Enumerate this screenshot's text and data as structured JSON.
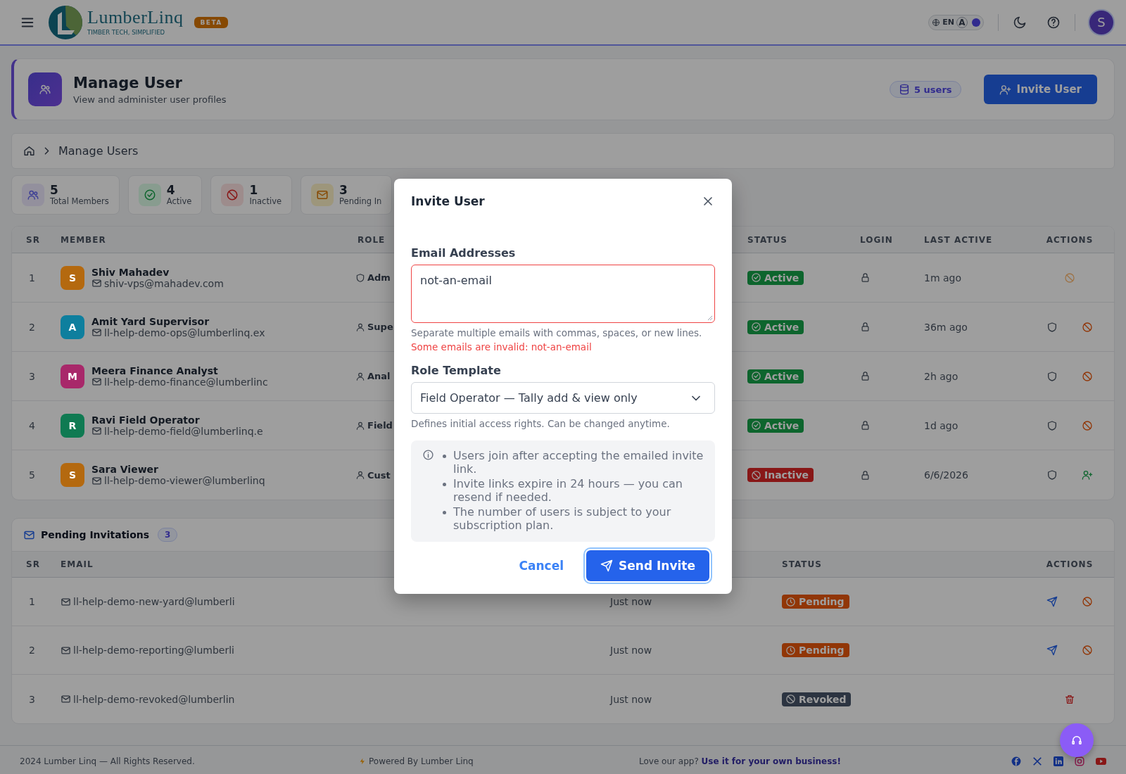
{
  "header": {
    "logo_name": "LumberLinq",
    "logo_tagline": "TIMBER TECH, SIMPLIFIED",
    "badge": "BETA",
    "language": "EN",
    "font_toggle": "A",
    "avatar": "S"
  },
  "page_header": {
    "title": "Manage User",
    "subtitle": "View and administer user profiles",
    "count": "5 users",
    "invite_button": "Invite User"
  },
  "breadcrumb": {
    "current": "Manage Users"
  },
  "stats": [
    {
      "kind": "members",
      "value": "5",
      "label": "Total Members"
    },
    {
      "kind": "active",
      "value": "4",
      "label": "Active"
    },
    {
      "kind": "inactive",
      "value": "1",
      "label": "Inactive"
    },
    {
      "kind": "pending",
      "value": "3",
      "label": "Pending In"
    }
  ],
  "members": {
    "columns": [
      "SR",
      "MEMBER",
      "ROLE",
      "STATUS",
      "LOGIN",
      "LAST ACTIVE",
      "ACTIONS"
    ],
    "rows": [
      {
        "sr": "1",
        "initial": "S",
        "color": "#b4690f",
        "name": "Shiv Mahadev",
        "email": "shiv-vps@mahadev.com",
        "role": {
          "kind": "admin",
          "label": "Adm"
        },
        "status": {
          "kind": "active",
          "label": "Active"
        },
        "last_active": "1m ago",
        "actions": [
          {
            "kind": "block",
            "disabled": true
          }
        ]
      },
      {
        "sr": "2",
        "initial": "A",
        "color": "#0e7f9e",
        "name": "Amit Yard Supervisor",
        "email": "ll-help-demo-ops@lumberlinq.ex",
        "role": {
          "kind": "user",
          "label": "Supe"
        },
        "status": {
          "kind": "active",
          "label": "Active"
        },
        "last_active": "36m ago",
        "actions": [
          {
            "kind": "permissions",
            "disabled": false
          },
          {
            "kind": "block",
            "disabled": false
          }
        ]
      },
      {
        "sr": "3",
        "initial": "M",
        "color": "#a8286a",
        "name": "Meera Finance Analyst",
        "email": "ll-help-demo-finance@lumberlinc",
        "role": {
          "kind": "user",
          "label": "Anal"
        },
        "status": {
          "kind": "active",
          "label": "Active"
        },
        "last_active": "2h ago",
        "actions": [
          {
            "kind": "permissions",
            "disabled": false
          },
          {
            "kind": "block",
            "disabled": false
          }
        ]
      },
      {
        "sr": "4",
        "initial": "R",
        "color": "#0f7a52",
        "name": "Ravi Field Operator",
        "email": "ll-help-demo-field@lumberlinq.e",
        "role": {
          "kind": "user",
          "label": "Field"
        },
        "status": {
          "kind": "active",
          "label": "Active"
        },
        "last_active": "1d ago",
        "actions": [
          {
            "kind": "permissions",
            "disabled": false
          },
          {
            "kind": "block",
            "disabled": false
          }
        ]
      },
      {
        "sr": "5",
        "initial": "S",
        "color": "#b4690f",
        "name": "Sara Viewer",
        "email": "ll-help-demo-viewer@lumberlinq",
        "role": {
          "kind": "user",
          "label": "Cust"
        },
        "status": {
          "kind": "inactive",
          "label": "Inactive"
        },
        "last_active": "6/6/2026",
        "actions": [
          {
            "kind": "permissions",
            "disabled": false
          },
          {
            "kind": "activate",
            "disabled": false
          }
        ]
      }
    ]
  },
  "invitations": {
    "title": "Pending Invitations",
    "count": "3",
    "columns": [
      "SR",
      "EMAIL",
      "STATUS",
      "ACTIONS"
    ],
    "rows": [
      {
        "sr": "1",
        "email": "ll-help-demo-new-yard@lumberli",
        "date": "Just now",
        "status": {
          "kind": "pending",
          "label": "Pending"
        },
        "actions": [
          {
            "kind": "resend"
          },
          {
            "kind": "revoke"
          }
        ]
      },
      {
        "sr": "2",
        "email": "ll-help-demo-reporting@lumberli",
        "date": "Just now",
        "status": {
          "kind": "pending",
          "label": "Pending"
        },
        "actions": [
          {
            "kind": "resend"
          },
          {
            "kind": "revoke"
          }
        ]
      },
      {
        "sr": "3",
        "email": "ll-help-demo-revoked@lumberlin",
        "date": "Just now",
        "status": {
          "kind": "revoked",
          "label": "Revoked"
        },
        "actions": [
          {
            "kind": "delete"
          }
        ]
      }
    ]
  },
  "modal": {
    "title": "Invite User",
    "email_label": "Email Addresses",
    "email_value": "not-an-email",
    "invalid": true,
    "email_hint": "Separate multiple emails with commas, spaces, or new lines.",
    "email_error": "Some emails are invalid: not-an-email",
    "role_label": "Role Template",
    "role_value": "Field Operator — Tally add & view only",
    "role_hint": "Defines initial access rights. Can be changed anytime.",
    "notes": [
      "Users join after accepting the emailed invite link.",
      "Invite links expire in 24 hours — you can resend if needed.",
      "The number of users is subject to your subscription plan."
    ],
    "cancel": "Cancel",
    "submit": "Send Invite"
  },
  "footer": {
    "copyright": "2024 Lumber Linq — All Rights Reserved.",
    "powered": "Powered By Lumber Linq",
    "promo": "Love our app?",
    "promo_link": "Use it for your own business!",
    "social": [
      {
        "kind": "facebook"
      },
      {
        "kind": "x"
      },
      {
        "kind": "linkedin"
      },
      {
        "kind": "instagram"
      },
      {
        "kind": "youtube"
      }
    ]
  }
}
